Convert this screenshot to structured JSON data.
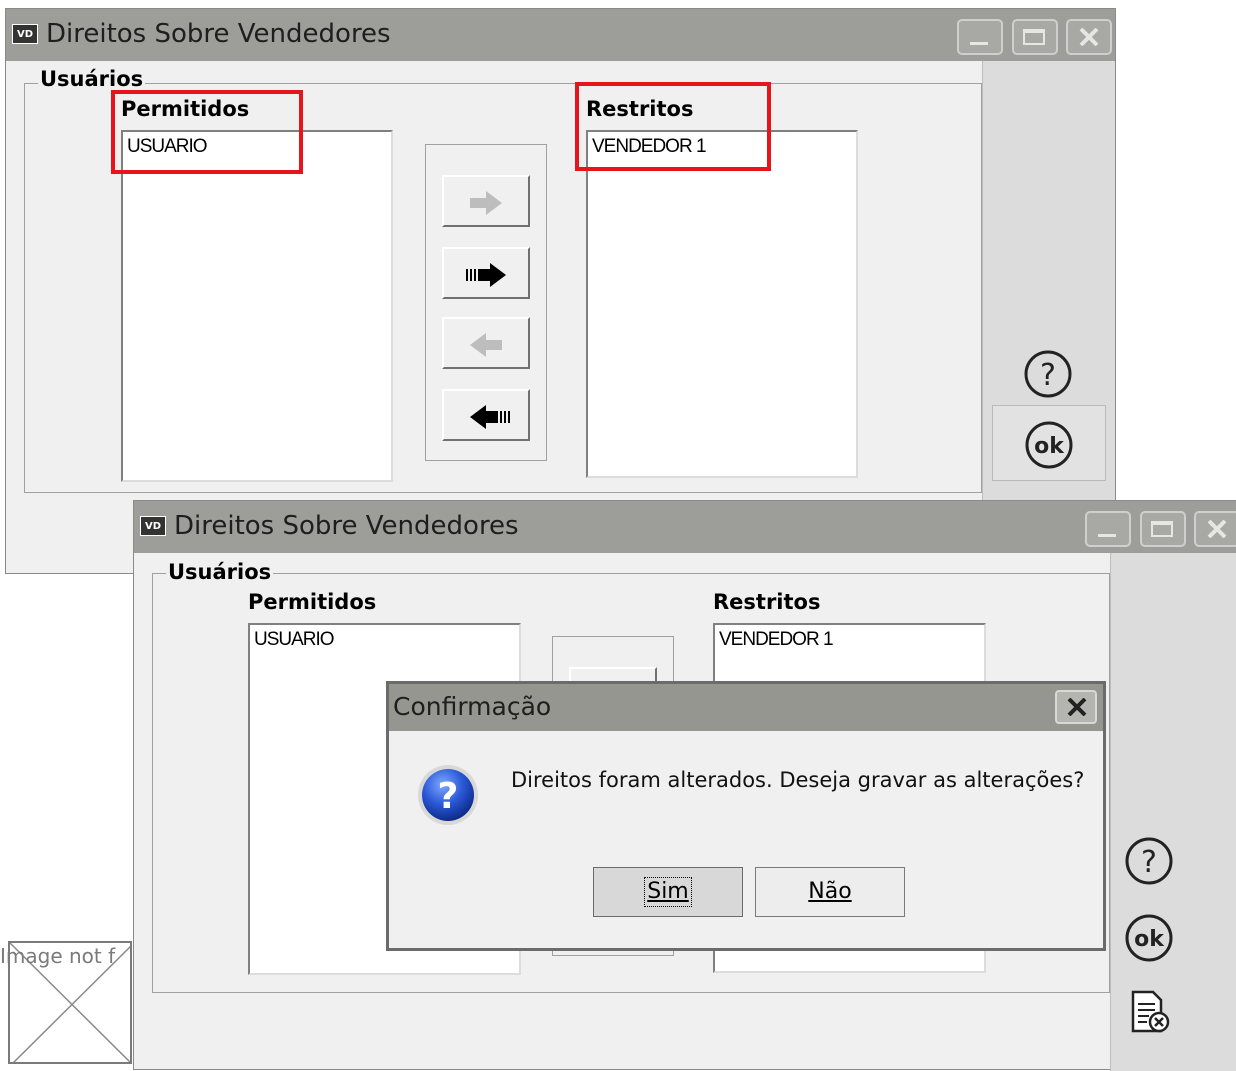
{
  "window_top": {
    "title": "Direitos Sobre Vendedores",
    "app_icon": "VD",
    "group_label": "Usuários",
    "permitted_label": "Permitidos",
    "permitted_items": [
      "USUARIO"
    ],
    "restricted_label": "Restritos",
    "restricted_items": [
      "VENDEDOR 1"
    ]
  },
  "window_bottom": {
    "title": "Direitos Sobre Vendedores",
    "app_icon": "VD",
    "group_label": "Usuários",
    "permitted_label": "Permitidos",
    "permitted_items": [
      "USUARIO"
    ],
    "restricted_label": "Restritos",
    "restricted_items": [
      "VENDEDOR 1"
    ]
  },
  "dialog": {
    "title": "Confirmação",
    "message": "Direitos foram alterados. Deseja gravar as alterações?",
    "yes_label": "Sim",
    "no_label": "Não"
  },
  "broken_image": {
    "text": "Image not f"
  },
  "icons": {
    "help": "help-icon",
    "ok": "ok-icon",
    "cancel_doc": "document-cancel-icon",
    "question": "question-icon"
  },
  "colors": {
    "highlight": "#e8141b",
    "titlebar": "#9d9d99",
    "window_bg": "#f0f0f0"
  }
}
